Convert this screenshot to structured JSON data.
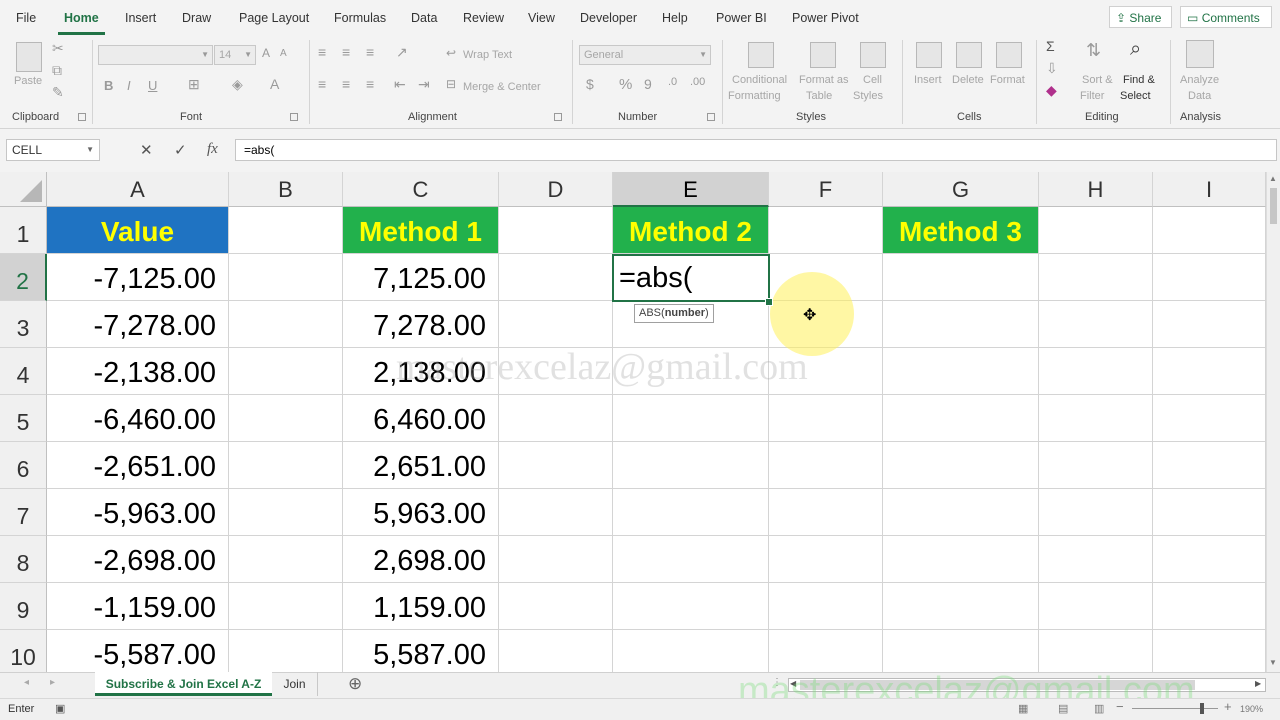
{
  "ribbon": {
    "tabs": [
      "File",
      "Home",
      "Insert",
      "Draw",
      "Page Layout",
      "Formulas",
      "Data",
      "Review",
      "View",
      "Developer",
      "Help",
      "Power BI",
      "Power Pivot"
    ],
    "active_tab": "Home",
    "share_label": "Share",
    "comments_label": "Comments",
    "groups": {
      "clipboard": {
        "label": "Clipboard",
        "paste": "Paste"
      },
      "font": {
        "label": "Font",
        "size": "14",
        "bold": "B",
        "italic": "I",
        "underline": "U"
      },
      "alignment": {
        "label": "Alignment",
        "wrap_text": "Wrap Text",
        "merge_center": "Merge & Center"
      },
      "number": {
        "label": "Number",
        "format": "General",
        "percent": "%"
      },
      "styles": {
        "label": "Styles",
        "conditional_1": "Conditional",
        "conditional_2": "Formatting",
        "format_as_1": "Format as",
        "format_as_2": "Table",
        "cell_styles_1": "Cell",
        "cell_styles_2": "Styles"
      },
      "cells": {
        "label": "Cells",
        "insert": "Insert",
        "delete": "Delete",
        "format": "Format"
      },
      "editing": {
        "label": "Editing",
        "sort_1": "Sort &",
        "sort_2": "Filter",
        "find_1": "Find &",
        "find_2": "Select"
      },
      "analysis": {
        "label": "Analysis",
        "analyze_1": "Analyze",
        "analyze_2": "Data"
      }
    }
  },
  "formula_bar": {
    "name_box": "CELL",
    "cancel": "✕",
    "enter": "✓",
    "fx": "fx",
    "formula": "=abs("
  },
  "grid": {
    "columns": [
      "A",
      "B",
      "C",
      "D",
      "E",
      "F",
      "G",
      "H",
      "I"
    ],
    "rows": [
      "1",
      "2",
      "3",
      "4",
      "5",
      "6",
      "7",
      "8",
      "9",
      "10"
    ],
    "headers": {
      "A1": "Value",
      "C1": "Method 1",
      "E1": "Method 2",
      "G1": "Method 3"
    },
    "values": [
      "-7,125.00",
      "-7,278.00",
      "-2,138.00",
      "-6,460.00",
      "-2,651.00",
      "-5,963.00",
      "-2,698.00",
      "-1,159.00",
      "-5,587.00"
    ],
    "method1": [
      "7,125.00",
      "7,278.00",
      "2,138.00",
      "6,460.00",
      "2,651.00",
      "5,963.00",
      "2,698.00",
      "1,159.00",
      "5,587.00"
    ],
    "active_cell_text": "=abs(",
    "tooltip_fn": "ABS(",
    "tooltip_arg": "number",
    "tooltip_end": ")"
  },
  "colors": {
    "blue_header": "#1f73c2",
    "green_header": "#22b14c",
    "header_text": "#ffff00",
    "accent": "#217346"
  },
  "watermark": "masterexcelaz@gmail.com",
  "sheets": [
    "Subscribe & Join Excel A-Z",
    "Join"
  ],
  "status": {
    "mode": "Enter",
    "zoom": "190%"
  }
}
